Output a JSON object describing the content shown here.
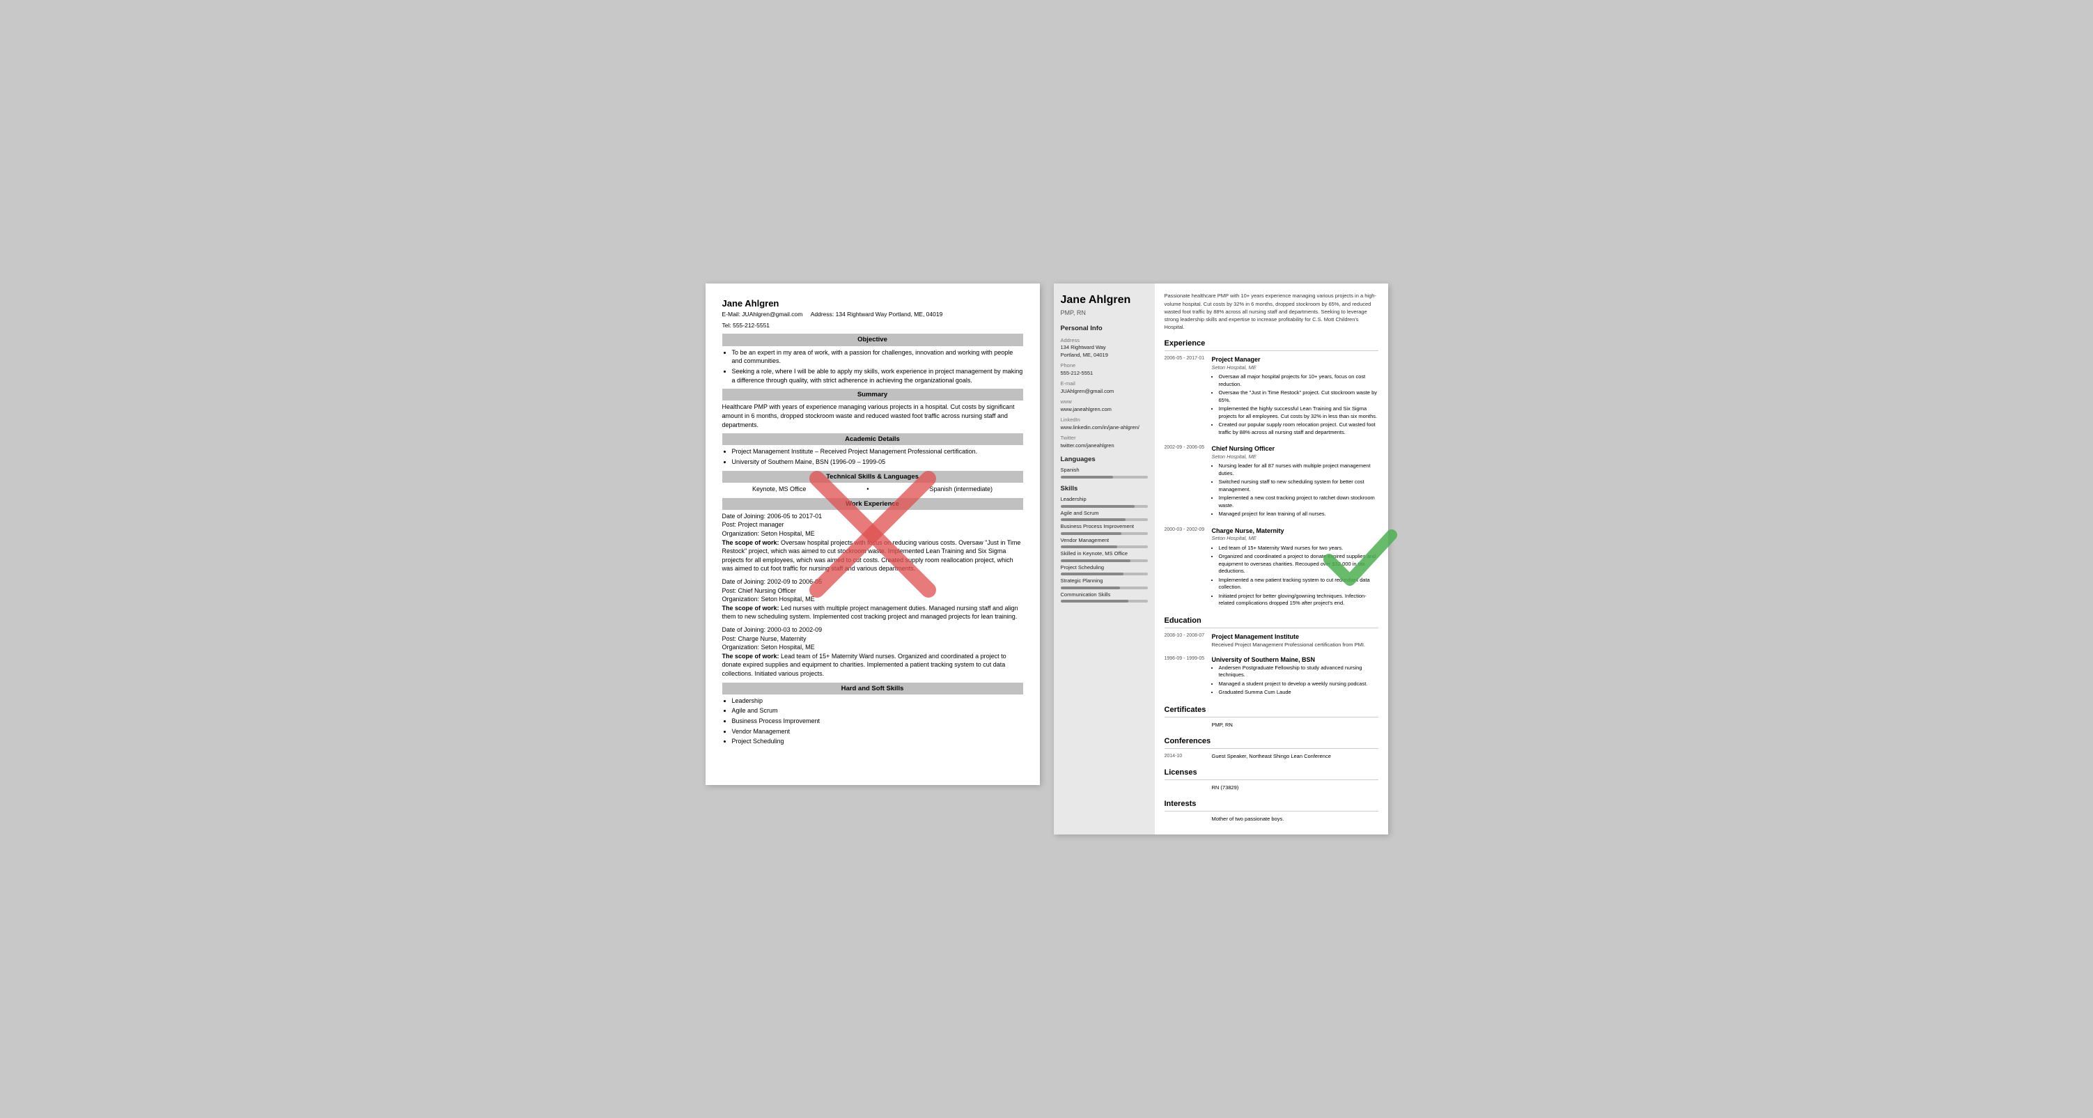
{
  "left_resume": {
    "name": "Jane Ahlgren",
    "contact": {
      "email": "E-Mail: JUAhlgren@gmail.com",
      "address": "Address: 134 Rightward Way Portland, ME, 04019",
      "tel": "Tel: 555-212-5551"
    },
    "objective_header": "Objective",
    "objective_items": [
      "To be an expert in my area of work, with a passion for challenges, innovation and working with people and communities.",
      "Seeking a role, where I will be able to apply my skills, work experience in project management by making a difference through quality, with strict adherence in achieving the organizational goals."
    ],
    "summary_header": "Summary",
    "summary_text": "Healthcare PMP with years of experience managing various projects in a hospital. Cut costs by significant amount in 6 months, dropped stockroom waste and reduced wasted foot traffic across nursing staff and departments.",
    "academic_header": "Academic Details",
    "academic_items": [
      "Project Management Institute – Received Project Management Professional certification.",
      "University of Southern Maine, BSN (1996-09 – 1999-05"
    ],
    "technical_header": "Technical Skills & Languages",
    "skills": [
      "Keynote, MS Office",
      "Spanish (intermediate)"
    ],
    "work_header": "Work Experience",
    "work_entries": [
      {
        "date": "Date of Joining: 2006-05 to 2017-01",
        "post": "Post: Project manager",
        "org": "Organization: Seton Hospital, ME",
        "scope_label": "The scope of work:",
        "scope_text": "Oversaw hospital projects with focus on reducing various costs. Oversaw \"Just in Time Restock\" project, which was aimed to cut stockroom waste. Implemented Lean Training and Six Sigma projects for all employees, which was aimed to cut costs. Created supply room reallocation project, which was aimed to cut foot traffic for nursing staff and various departments."
      },
      {
        "date": "Date of Joining: 2002-09 to 2006-05",
        "post": "Post: Chief Nursing Officer",
        "org": "Organization: Seton Hospital, ME",
        "scope_label": "The scope of work:",
        "scope_text": "Led nurses with multiple project management duties. Managed nursing staff and align them to new scheduling system. Implemented cost tracking project and managed projects for lean training."
      },
      {
        "date": "Date of Joining: 2000-03 to 2002-09",
        "post": "Post: Charge Nurse, Maternity",
        "org": "Organization: Seton Hospital, ME",
        "scope_label": "The scope of work:",
        "scope_text": "Lead team of 15+ Maternity Ward nurses. Organized and coordinated a project to donate expired supplies and equipment to charities. Implemented a patient tracking system to cut data collections. Initiated various projects."
      }
    ],
    "hard_soft_header": "Hard and Soft Skills",
    "hard_soft_items": [
      "Leadership",
      "Agile and Scrum",
      "Business Process Improvement",
      "Vendor Management",
      "Project Scheduling"
    ]
  },
  "right_resume": {
    "name": "Jane Ahlgren",
    "title": "PMP, RN",
    "summary": "Passionate healthcare PMP with 10+ years experience managing various projects in a high-volume hospital. Cut costs by 32% in 6 months, dropped stockroom by 65%, and reduced wasted foot traffic by 88% across all nursing staff and departments. Seeking to leverage strong leadership skills and expertise to increase profitability for C.S. Mott Children's Hospital.",
    "sidebar": {
      "personal_info_title": "Personal Info",
      "address_label": "Address",
      "address_line1": "134 Rightward Way",
      "address_line2": "Portland, ME, 04019",
      "phone_label": "Phone",
      "phone": "555-212-5551",
      "email_label": "E-mail",
      "email": "JUAhlgren@gmail.com",
      "www_label": "www",
      "www": "www.janeahlgren.com",
      "linkedin_label": "LinkedIn",
      "linkedin": "www.linkedin.com/in/jane-ahlgren/",
      "twitter_label": "Twitter",
      "twitter": "twitter.com/janeahlgren",
      "languages_title": "Languages",
      "language": "Spanish",
      "language_bar": 60,
      "skills_title": "Skills",
      "skills": [
        {
          "name": "Leadership",
          "level": 85
        },
        {
          "name": "Agile and Scrum",
          "level": 75
        },
        {
          "name": "Business Process Improvement",
          "level": 70
        },
        {
          "name": "Vendor Management",
          "level": 65
        },
        {
          "name": "Skilled in Keynote, MS Office",
          "level": 80
        },
        {
          "name": "Project Scheduling",
          "level": 72
        },
        {
          "name": "Strategic Planning",
          "level": 68
        },
        {
          "name": "Communication Skills",
          "level": 78
        }
      ]
    },
    "experience_title": "Experience",
    "experience": [
      {
        "dates": "2006-05 - 2017-01",
        "title": "Project Manager",
        "company": "Seton Hospital, ME",
        "bullets": [
          "Oversaw all major hospital projects for 10+ years, focus on cost reduction.",
          "Oversaw the \"Just in Time Restock\" project. Cut stockroom waste by 65%.",
          "Implemented the highly successful Lean Training and Six Sigma projects for all employees. Cut costs by 32% in less than six months.",
          "Created our popular supply room relocation project. Cut wasted foot traffic by 88% across all nursing staff and departments."
        ]
      },
      {
        "dates": "2002-09 - 2006-05",
        "title": "Chief Nursing Officer",
        "company": "Seton Hospital, ME",
        "bullets": [
          "Nursing leader for all 87 nurses with multiple project management duties.",
          "Switched nursing staff to new scheduling system for better cost management.",
          "Implemented a new cost tracking project to ratchet down stockroom waste.",
          "Managed project for lean training of all nurses."
        ]
      },
      {
        "dates": "2000-03 - 2002-09",
        "title": "Charge Nurse, Maternity",
        "company": "Seton Hospital, ME",
        "bullets": [
          "Led team of 15+ Maternity Ward nurses for two years.",
          "Organized and coordinated a project to donate expired supplies and equipment to overseas charities. Recouped over $32,000 in tax deductions.",
          "Implemented a new patient tracking system to cut redundant data collection.",
          "Initiated project for better gloving/gowning techniques. Infection-related complications dropped 15% after project's end."
        ]
      }
    ],
    "education_title": "Education",
    "education": [
      {
        "dates": "2008-10 - 2008-07",
        "school": "Project Management Institute",
        "desc": "Received Project Management Professional certification from PMI.",
        "bullets": []
      },
      {
        "dates": "1996-09 - 1999-05",
        "school": "University of Southern Maine, BSN",
        "desc": "",
        "bullets": [
          "Andersen Postgraduate Fellowship to study advanced nursing techniques.",
          "Managed a student project to develop a weekly nursing podcast.",
          "Graduated Summa Cum Laude"
        ]
      }
    ],
    "certificates_title": "Certificates",
    "certificates": [
      {
        "value": "PMP, RN"
      }
    ],
    "conferences_title": "Conferences",
    "conferences": [
      {
        "date": "2014-10",
        "value": "Guest Speaker, Northeast Shingo Lean Conference"
      }
    ],
    "licenses_title": "Licenses",
    "licenses": [
      {
        "value": "RN (73829)"
      }
    ],
    "interests_title": "Interests",
    "interests": [
      {
        "value": "Mother of two passionate boys."
      }
    ]
  }
}
